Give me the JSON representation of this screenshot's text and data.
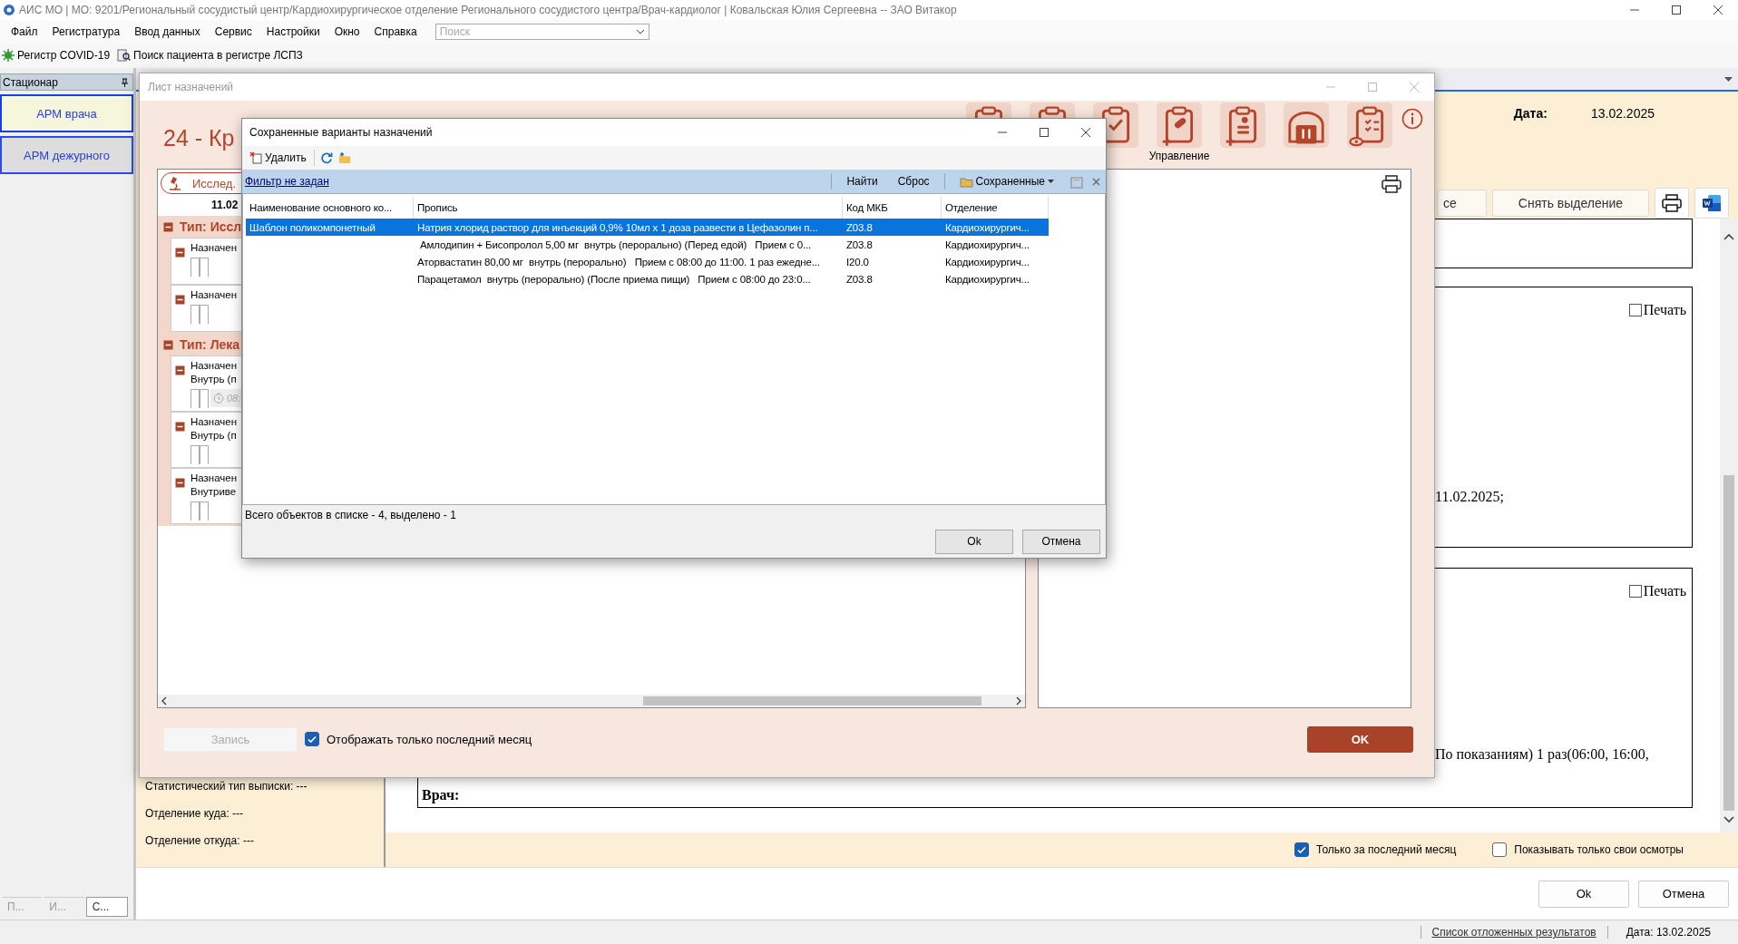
{
  "window": {
    "title": "АИС МО | МО: 9201/Региональный сосудистый центр/Кардиохирургическое отделение Регионального сосудистого центра/Врач-кардиолог | Ковальская Юлия Сергеевна -- ЗАО Витакор"
  },
  "menu": [
    "Файл",
    "Регистратура",
    "Ввод данных",
    "Сервис",
    "Настройки",
    "Окно",
    "Справка"
  ],
  "search": {
    "placeholder": "Поиск"
  },
  "toolbar": [
    "Регистр COVID-19",
    "Поиск пациента в регистре ЛСПЗ"
  ],
  "sidebar": {
    "title": "Стационар",
    "items": [
      {
        "label": "АРМ врача",
        "selected": true
      },
      {
        "label": "АРМ дежурного",
        "selected": false
      }
    ],
    "tabs": [
      {
        "label": "П...",
        "selected": false
      },
      {
        "label": "И...",
        "selected": false
      },
      {
        "label": "С...",
        "selected": true
      }
    ]
  },
  "patient": {
    "date_label": "Дата:",
    "date": "13.02.2025",
    "buttons": [
      "се",
      "Снять выделение"
    ],
    "info": [
      "Статистический тип выписки: ---",
      "Отделение куда: ---",
      "Отделение откуда: ---"
    ],
    "documents": [
      {
        "print": {
          "label": "Печать",
          "checked": false
        },
        "lines": [
          "11.02.2025;"
        ]
      },
      {
        "print": {
          "label": "Печать",
          "checked": false
        },
        "lines": [
          "По показаниям) 1 раз(06:00, 16:00,"
        ],
        "doctor_label": "Врач:"
      }
    ],
    "filters": [
      {
        "label": "Только за последний месяц",
        "checked": true
      },
      {
        "label": "Показывать только свои осмотры",
        "checked": false
      }
    ],
    "buttons_bottom": [
      "Ok",
      "Отмена"
    ]
  },
  "status_bar": {
    "link": "Список отложенных результатов",
    "date": "Дата: 13.02.2025"
  },
  "sheet": {
    "title": "Лист назначений",
    "heading": "24 - Кр",
    "tool_label": "Управление",
    "tab": "Исслед.",
    "date": "11.02",
    "groups": [
      {
        "title": "Тип: Иссл",
        "items": [
          {
            "lines": [
              "Назначен"
            ]
          },
          {
            "lines": [
              "Назначен"
            ]
          }
        ]
      },
      {
        "title": "Тип: Лека",
        "items": [
          {
            "lines": [
              "Назначен",
              "Внутрь (п"
            ],
            "time": "08:"
          },
          {
            "lines": [
              "Назначен",
              "Внутрь (п"
            ]
          },
          {
            "lines": [
              "Назначен",
              "Внутриве"
            ]
          }
        ]
      }
    ],
    "record_button": "Запись",
    "only_last_month": {
      "label": "Отображать только последний месяц",
      "checked": true
    },
    "ok": "OK"
  },
  "dialog": {
    "title": "Сохраненные варианты назначений",
    "delete": "Удалить",
    "filter_link": "Фильтр не задан",
    "find": "Найти",
    "reset": "Сброс",
    "saved": "Сохраненные",
    "columns": [
      "Наименование основного ко...",
      "Пропись",
      "Код МКБ",
      "Отделение"
    ],
    "rows": [
      {
        "name": "Шаблон поликомпонетный",
        "prescription": "Натрия хлорид раствор для инъекций 0,9% 10мл x 1 доза развести в Цефазолин п...",
        "icd": "Z03.8",
        "department": "Кардиохирургич...",
        "selected": true
      },
      {
        "prescription": " Амлодипин + Бисопролол 5,00 мг  внутрь (перорально) (Перед едой)   Прием с 0...",
        "icd": "Z03.8",
        "department": "Кардиохирургич...",
        "selected": false
      },
      {
        "prescription": "Аторвастатин 80,00 мг  внутрь (перорально)   Прием с 08:00 до 11:00. 1 раз ежедне...",
        "icd": "I20.0",
        "department": "Кардиохирургич...",
        "selected": false
      },
      {
        "prescription": "Парацетамол  внутрь (перорально) (После приема пищи)   Прием с 08:00 до 23:0...",
        "icd": "Z03.8",
        "department": "Кардиохирургич...",
        "selected": false
      }
    ],
    "status": "Всего объектов в списке - 4, выделено - 1",
    "ok": "Ok",
    "cancel": "Отмена"
  }
}
